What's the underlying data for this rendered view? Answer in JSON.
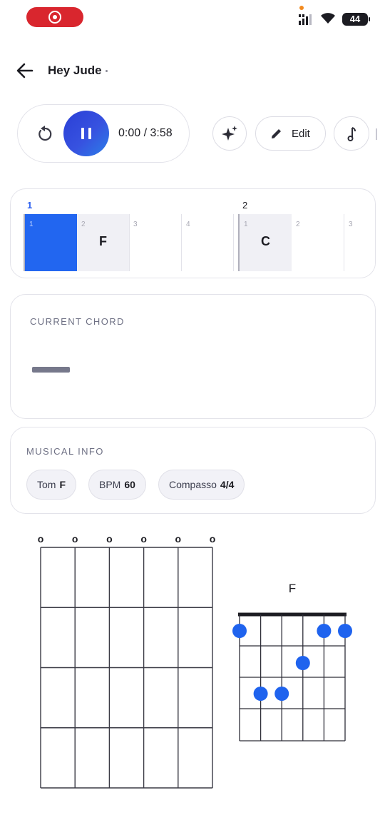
{
  "status_bar": {
    "battery": "44",
    "icons": [
      "record-indicator",
      "signal-icon",
      "wifi-icon",
      "battery-icon"
    ]
  },
  "header": {
    "title": "Hey Jude",
    "back_icon": "arrow-left-icon"
  },
  "player": {
    "replay_icon": "replay-icon",
    "pause_icon": "pause-icon",
    "time": "0:00 / 3:58"
  },
  "actions": {
    "sparkle_icon": "sparkle-icon",
    "edit_label": "Edit",
    "edit_icon": "pencil-icon",
    "note_icon": "music-note-icon"
  },
  "measures": [
    {
      "number": "1",
      "active": true,
      "beats": [
        {
          "n": "1",
          "chord": "",
          "style": "blue"
        },
        {
          "n": "2",
          "chord": "F",
          "style": "grey"
        },
        {
          "n": "3",
          "chord": "",
          "style": "plain"
        },
        {
          "n": "4",
          "chord": "",
          "style": "plain"
        }
      ]
    },
    {
      "number": "2",
      "active": false,
      "beats": [
        {
          "n": "1",
          "chord": "C",
          "style": "grey"
        },
        {
          "n": "2",
          "chord": "",
          "style": "plain"
        },
        {
          "n": "3",
          "chord": "",
          "style": "plain"
        }
      ]
    }
  ],
  "current_chord": {
    "label": "CURRENT CHORD"
  },
  "musical_info": {
    "label": "MUSICAL INFO",
    "chips": [
      {
        "key": "Tom",
        "value": "F"
      },
      {
        "key": "BPM",
        "value": "60"
      },
      {
        "key": "Compasso",
        "value": "4/4"
      }
    ]
  },
  "open_strings": {
    "markers": [
      "o",
      "o",
      "o",
      "o",
      "o",
      "o"
    ]
  },
  "chord_diagram": {
    "name": "F",
    "accent": "#1f63ee",
    "dots": [
      {
        "string": 1,
        "fret": 0
      },
      {
        "string": 5,
        "fret": 0
      },
      {
        "string": 6,
        "fret": 0
      },
      {
        "string": 4,
        "fret": 1
      },
      {
        "string": 2,
        "fret": 2
      },
      {
        "string": 3,
        "fret": 2
      }
    ]
  }
}
